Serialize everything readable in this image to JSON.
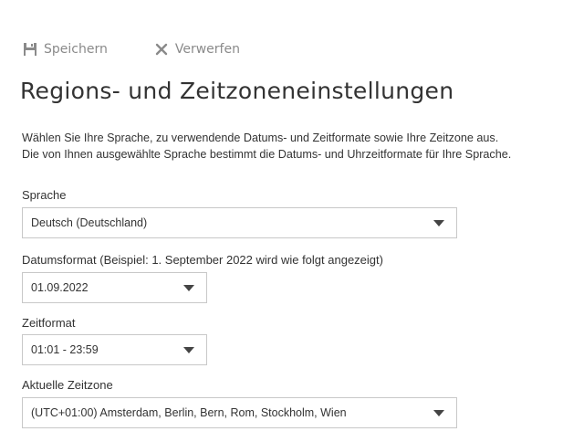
{
  "toolbar": {
    "save_label": "Speichern",
    "save_icon": "floppy-disk-icon",
    "discard_label": "Verwerfen",
    "discard_icon": "x-icon",
    "disabled_color": "#8a8a8a"
  },
  "page": {
    "title": "Regions- und Zeitzoneneinstellungen",
    "description_line1": "Wählen Sie Ihre Sprache, zu verwendende Datums- und Zeitformate sowie Ihre Zeitzone aus.",
    "description_line2": "Die von Ihnen ausgewählte Sprache bestimmt die Datums- und Uhrzeitformate für Ihre Sprache."
  },
  "fields": {
    "language": {
      "label": "Sprache",
      "value": "Deutsch (Deutschland)"
    },
    "date_format": {
      "label": "Datumsformat (Beispiel: 1. September 2022 wird wie folgt angezeigt)",
      "value": "01.09.2022"
    },
    "time_format": {
      "label": "Zeitformat",
      "value": "01:01 - 23:59"
    },
    "timezone": {
      "label": "Aktuelle Zeitzone",
      "value": "(UTC+01:00) Amsterdam, Berlin, Bern, Rom, Stockholm, Wien"
    }
  },
  "icons": {
    "dropdown": "chevron-down-icon"
  }
}
